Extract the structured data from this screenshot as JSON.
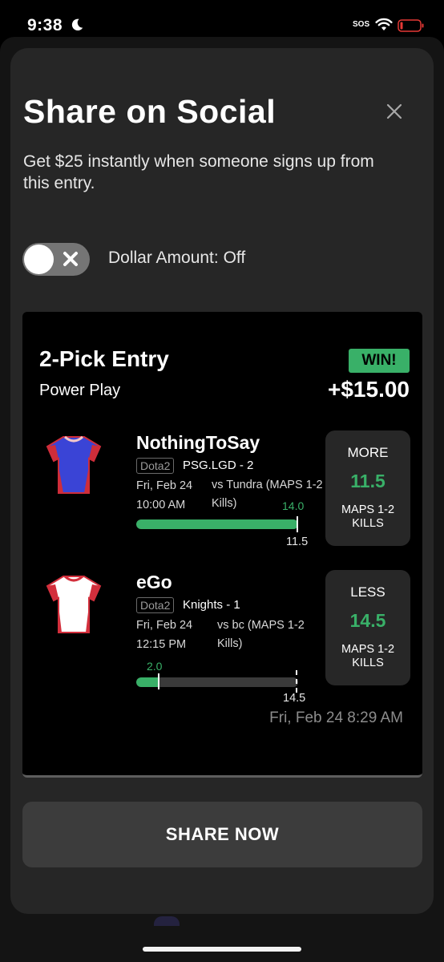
{
  "status_bar": {
    "time": "9:38",
    "moon_icon": "moon-icon",
    "sos": "SOS",
    "wifi_icon": "wifi-icon",
    "battery_icon": "battery-low-icon",
    "battery_color": "#e53935"
  },
  "modal": {
    "title": "Share on Social",
    "close_icon": "close-icon",
    "subtitle": "Get $25 instantly when someone signs up from this entry.",
    "toggle": {
      "state": "off",
      "label": "Dollar Amount: Off"
    },
    "share_button": "SHARE NOW"
  },
  "entry": {
    "title": "2-Pick Entry",
    "type": "Power Play",
    "result_badge": "WIN!",
    "payout": "+$15.00",
    "timestamp": "Fri, Feb 24 8:29 AM",
    "accent_color": "#39b068",
    "picks": [
      {
        "player": "NothingToSay",
        "game": "Dota2",
        "team": "PSG.LGD - 2",
        "date": "Fri, Feb 24",
        "time": "10:00 AM",
        "opponent": "vs Tundra (MAPS 1-2 Kills)",
        "actual": "14.0",
        "line": "11.5",
        "direction": "MORE",
        "stat": "MAPS 1-2 KILLS",
        "progress": 1.0,
        "jersey_color": "#3a44d6",
        "jersey_icon": "jersey-icon"
      },
      {
        "player": "eGo",
        "game": "Dota2",
        "team": "Knights - 1",
        "date": "Fri, Feb 24",
        "time": "12:15 PM",
        "opponent": "vs bc (MAPS 1-2 Kills)",
        "actual": "2.0",
        "line": "14.5",
        "direction": "LESS",
        "stat": "MAPS 1-2 KILLS",
        "progress": 0.14,
        "jersey_color": "#ffffff",
        "jersey_icon": "jersey-icon"
      }
    ]
  }
}
